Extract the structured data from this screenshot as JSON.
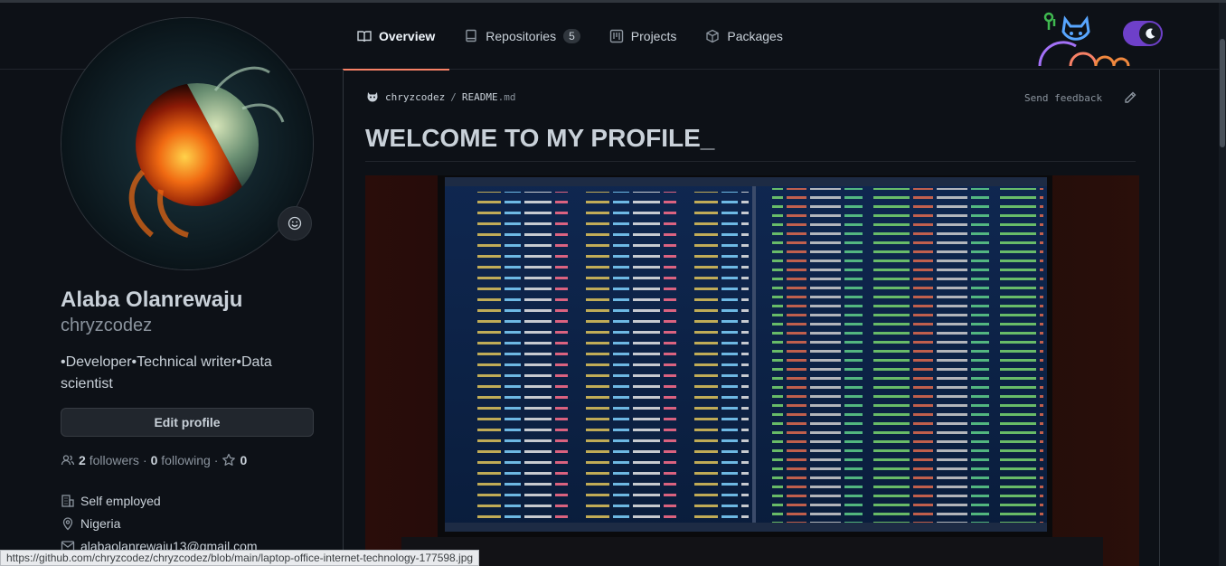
{
  "tabs": [
    {
      "label": "Overview",
      "icon": "book-icon",
      "active": true
    },
    {
      "label": "Repositories",
      "icon": "repo-icon",
      "count": "5"
    },
    {
      "label": "Projects",
      "icon": "project-icon"
    },
    {
      "label": "Packages",
      "icon": "package-icon"
    }
  ],
  "profile": {
    "full_name": "Alaba Olanrewaju",
    "username": "chryzcodez",
    "bio": "•Developer•Technical writer•Data scientist",
    "edit_label": "Edit profile",
    "followers_count": "2",
    "followers_label": "followers",
    "following_count": "0",
    "following_label": "following",
    "stars_count": "0",
    "details": {
      "company": "Self employed",
      "location": "Nigeria",
      "email": "alabaolanrewaju13@gmail.com"
    }
  },
  "readme": {
    "owner": "chryzcodez",
    "separator": "/",
    "file": "README",
    "ext": ".md",
    "feedback_label": "Send feedback",
    "heading": "WELCOME TO MY PROFILE_"
  },
  "status_bar_url": "https://github.com/chryzcodez/chryzcodez/blob/main/laptop-office-internet-technology-177598.jpg",
  "colors": {
    "background": "#0d1117",
    "active_tab_underline": "#f78166",
    "toggle": "#6e40c9"
  }
}
